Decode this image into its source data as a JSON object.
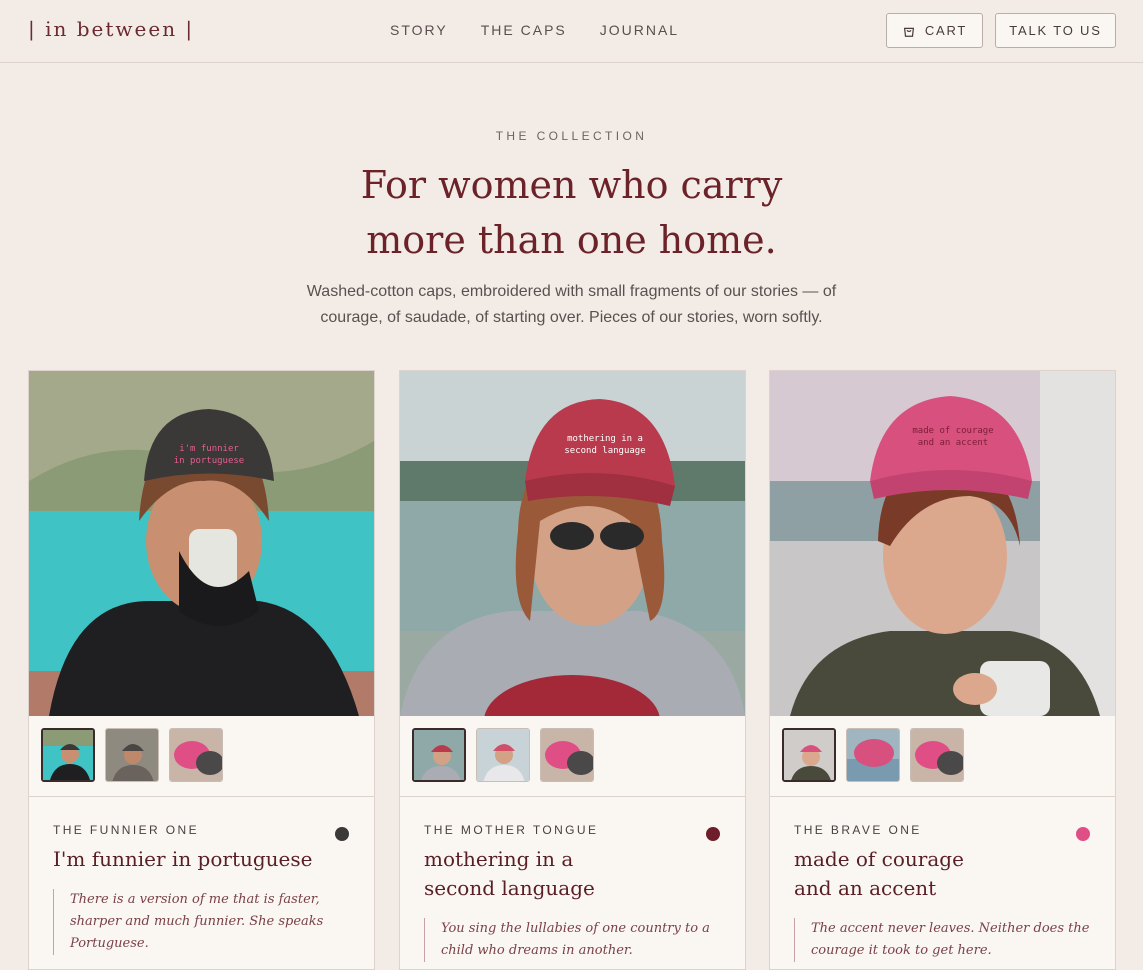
{
  "brand": {
    "logo": "| in between |"
  },
  "nav": {
    "links": [
      "STORY",
      "THE CAPS",
      "JOURNAL"
    ],
    "cart_label": "CART",
    "talk_label": "TALK TO US"
  },
  "hero": {
    "eyebrow": "THE COLLECTION",
    "headline_line1": "For women who carry",
    "headline_line2": "more than one home.",
    "subtitle": "Washed-cotton caps, embroidered with small fragments of our stories — of courage, of saudade, of starting over. Pieces of our stories, worn softly."
  },
  "products": [
    {
      "label": "THE FUNNIER ONE",
      "title": "I'm funnier in portuguese",
      "quote": "There is a version of me that is faster, sharper and much funnier. She speaks Portuguese.",
      "cap_color": "#3b3838",
      "embroidery": "i'm funnier in portuguese"
    },
    {
      "label": "THE MOTHER TONGUE",
      "title": "mothering in a second language",
      "quote": "You sing the lullabies of one country to a child who dreams in another.",
      "cap_color": "#6e1e2a",
      "embroidery": "mothering in a second language"
    },
    {
      "label": "THE BRAVE ONE",
      "title": "made of courage and an accent",
      "quote": "The accent never leaves. Neither does the courage it took to get here.",
      "cap_color": "#df4f86",
      "embroidery": "made of courage and an accent"
    }
  ]
}
